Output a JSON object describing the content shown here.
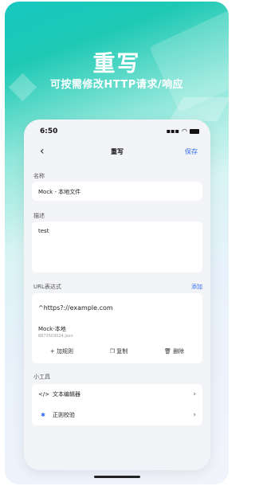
{
  "hero": {
    "title": "重写",
    "subtitle": "可按需修改HTTP请求/响应"
  },
  "status_bar": {
    "time": "6:50"
  },
  "nav": {
    "back_glyph": "‹",
    "title": "重写",
    "save_label": "保存"
  },
  "form": {
    "name_label": "名称",
    "name_value": "Mock - 本地文件",
    "desc_label": "描述",
    "desc_value": "test",
    "url_label": "URL表达式",
    "add_label": "添加"
  },
  "rule": {
    "url": "^https?://example.com",
    "name": "Mock-本地",
    "id": "6873503024.json",
    "actions": {
      "add": "+ 加规则",
      "copy": "复制",
      "delete": "删除"
    }
  },
  "tools": {
    "section_label": "小工具",
    "items": [
      {
        "label": "文本编辑器",
        "icon": "</>"
      },
      {
        "label": "正则校验",
        "icon": "✱"
      }
    ]
  }
}
